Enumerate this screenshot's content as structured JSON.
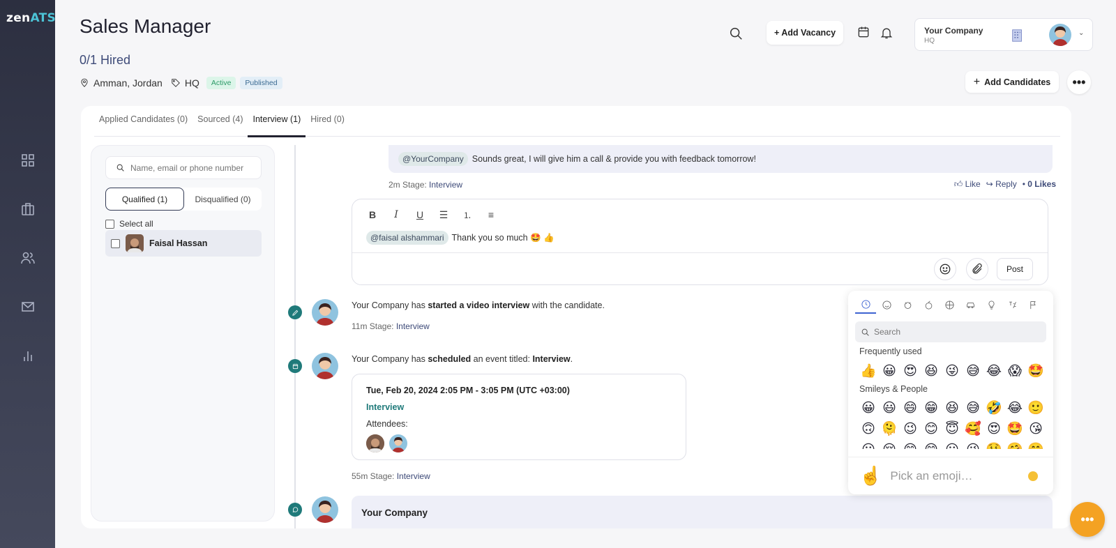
{
  "brand": {
    "logo_prefix": "zen",
    "logo_suffix": "ATS"
  },
  "header": {
    "title": "Sales Manager",
    "hired": "0/1 Hired",
    "location": "Amman, Jordan",
    "branch": "HQ",
    "status_badge": "Active",
    "publish_badge": "Published",
    "add_vacancy_label": "+ Add Vacancy",
    "company_name": "Your Company",
    "company_sub": "HQ",
    "add_candidates_label": "Add Candidates",
    "more_label": "•••"
  },
  "tabs": [
    {
      "label": "Applied Candidates (0)"
    },
    {
      "label": "Sourced (4)"
    },
    {
      "label": "Interview (1)"
    },
    {
      "label": "Hired (0)"
    }
  ],
  "left": {
    "search_placeholder": "Name, email or phone number",
    "qualified": "Qualified (1)",
    "disqualified": "Disqualified (0)",
    "select_all": "Select all",
    "candidate": "Faisal Hassan"
  },
  "feed": {
    "reply_mention": "@YourCompany",
    "reply_text": "Sounds great, I will give him a call & provide you with feedback tomorrow!",
    "reply_time": "2m Stage:",
    "reply_stage": "Interview",
    "like": "Like",
    "reply": "Reply",
    "likes": "0 Likes",
    "editor_mention": "@faisal alshammari",
    "editor_text": "Thank you so much 🤩 👍",
    "post": "Post",
    "ev1_a": "Your Company has",
    "ev1_b": "started a video interview",
    "ev1_c": "with the candidate.",
    "ev1_time": "11m Stage:",
    "ev1_stage": "Interview",
    "ev2_a": "Your Company has",
    "ev2_b": "scheduled",
    "ev2_c": "an event titled:",
    "ev2_d": "Interview",
    "ev2_e": ".",
    "event_date": "Tue, Feb 20, 2024 2:05 PM - 3:05 PM (UTC +03:00)",
    "event_title": "Interview",
    "event_attendees": "Attendees:",
    "ev2_time": "55m Stage:",
    "ev2_stage": "Interview",
    "last_name": "Your Company"
  },
  "emoji_picker": {
    "search_placeholder": "Search",
    "frequently_used": "Frequently used",
    "smileys": "Smileys & People",
    "placeholder": "Pick an emoji…",
    "frequent": [
      "👍",
      "😀",
      "😍",
      "😆",
      "😜",
      "😅",
      "😂",
      "😱",
      "🤩"
    ],
    "smiley_rows": [
      [
        "😀",
        "😃",
        "😄",
        "😁",
        "😆",
        "😅",
        "🤣",
        "😂",
        "🙂"
      ],
      [
        "🙃",
        "🫠",
        "😉",
        "😊",
        "😇",
        "🥰",
        "😍",
        "🤩",
        "😘"
      ],
      [
        "😗",
        "😚",
        "😙",
        "😋",
        "😛",
        "😜",
        "🤑",
        "🤗",
        "🤭"
      ]
    ]
  },
  "fab_label": "•••"
}
